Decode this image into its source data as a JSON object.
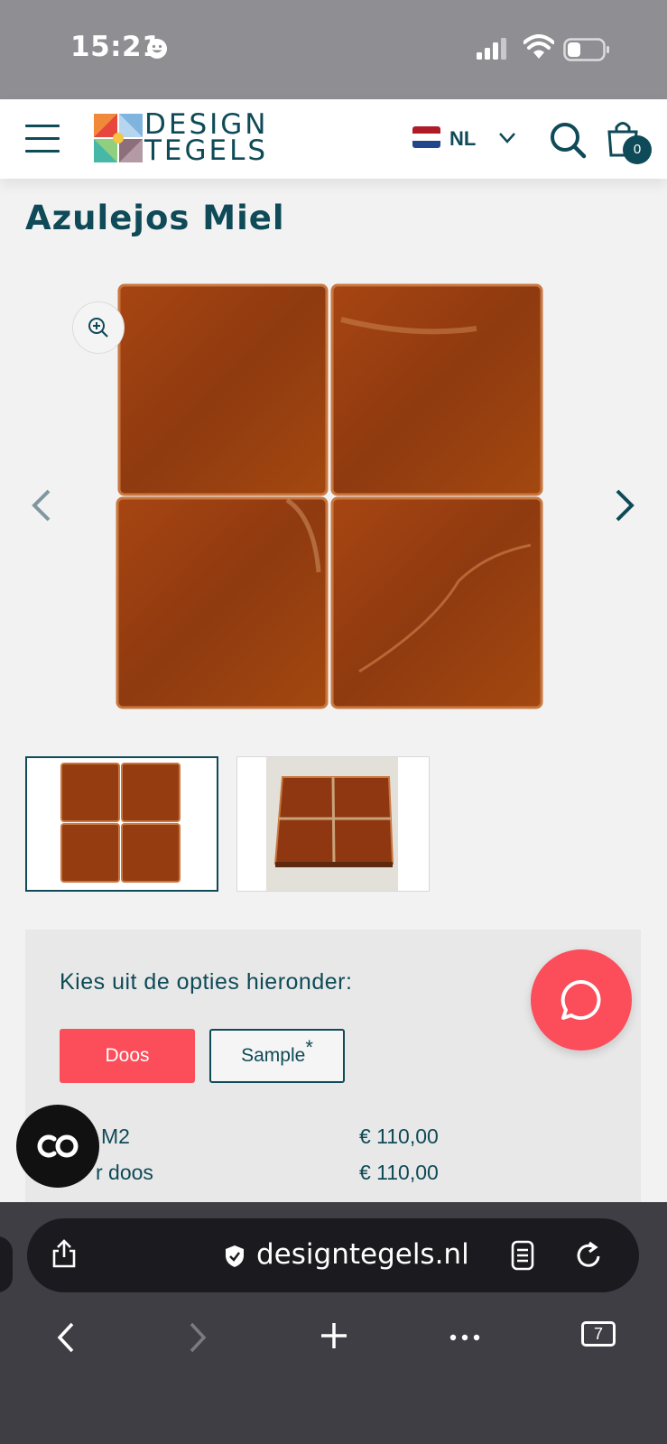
{
  "status_bar": {
    "time": "15:21"
  },
  "header": {
    "logo_line1": "DESIGN",
    "logo_line2": "TEGELS",
    "language": "NL",
    "cart_count": "0",
    "flag_colors": [
      "#ae1c28",
      "#ffffff",
      "#21468b"
    ]
  },
  "product": {
    "title": "Azulejos Miel"
  },
  "options": {
    "heading": "Kies uit de opties hieronder:",
    "doos_label": "Doos",
    "sample_label": "Sample",
    "sample_mark": "*",
    "prices": [
      {
        "label": "M2",
        "value": "€ 110,00"
      },
      {
        "label": "r doos",
        "value": "€ 110,00"
      }
    ]
  },
  "browser": {
    "url": "designtegels.nl",
    "tab_count": "7"
  },
  "colors": {
    "brand": "#0e4a57",
    "accent": "#fb4d5a",
    "tile": "#9c3f12"
  },
  "icons": [
    "menu-icon",
    "search-icon",
    "cart-icon",
    "zoom-in-icon",
    "chevron-left-icon",
    "chevron-right-icon",
    "chat-icon",
    "share-icon",
    "shield-icon",
    "reader-icon",
    "reload-icon",
    "plus-icon",
    "more-icon",
    "tabs-icon"
  ]
}
